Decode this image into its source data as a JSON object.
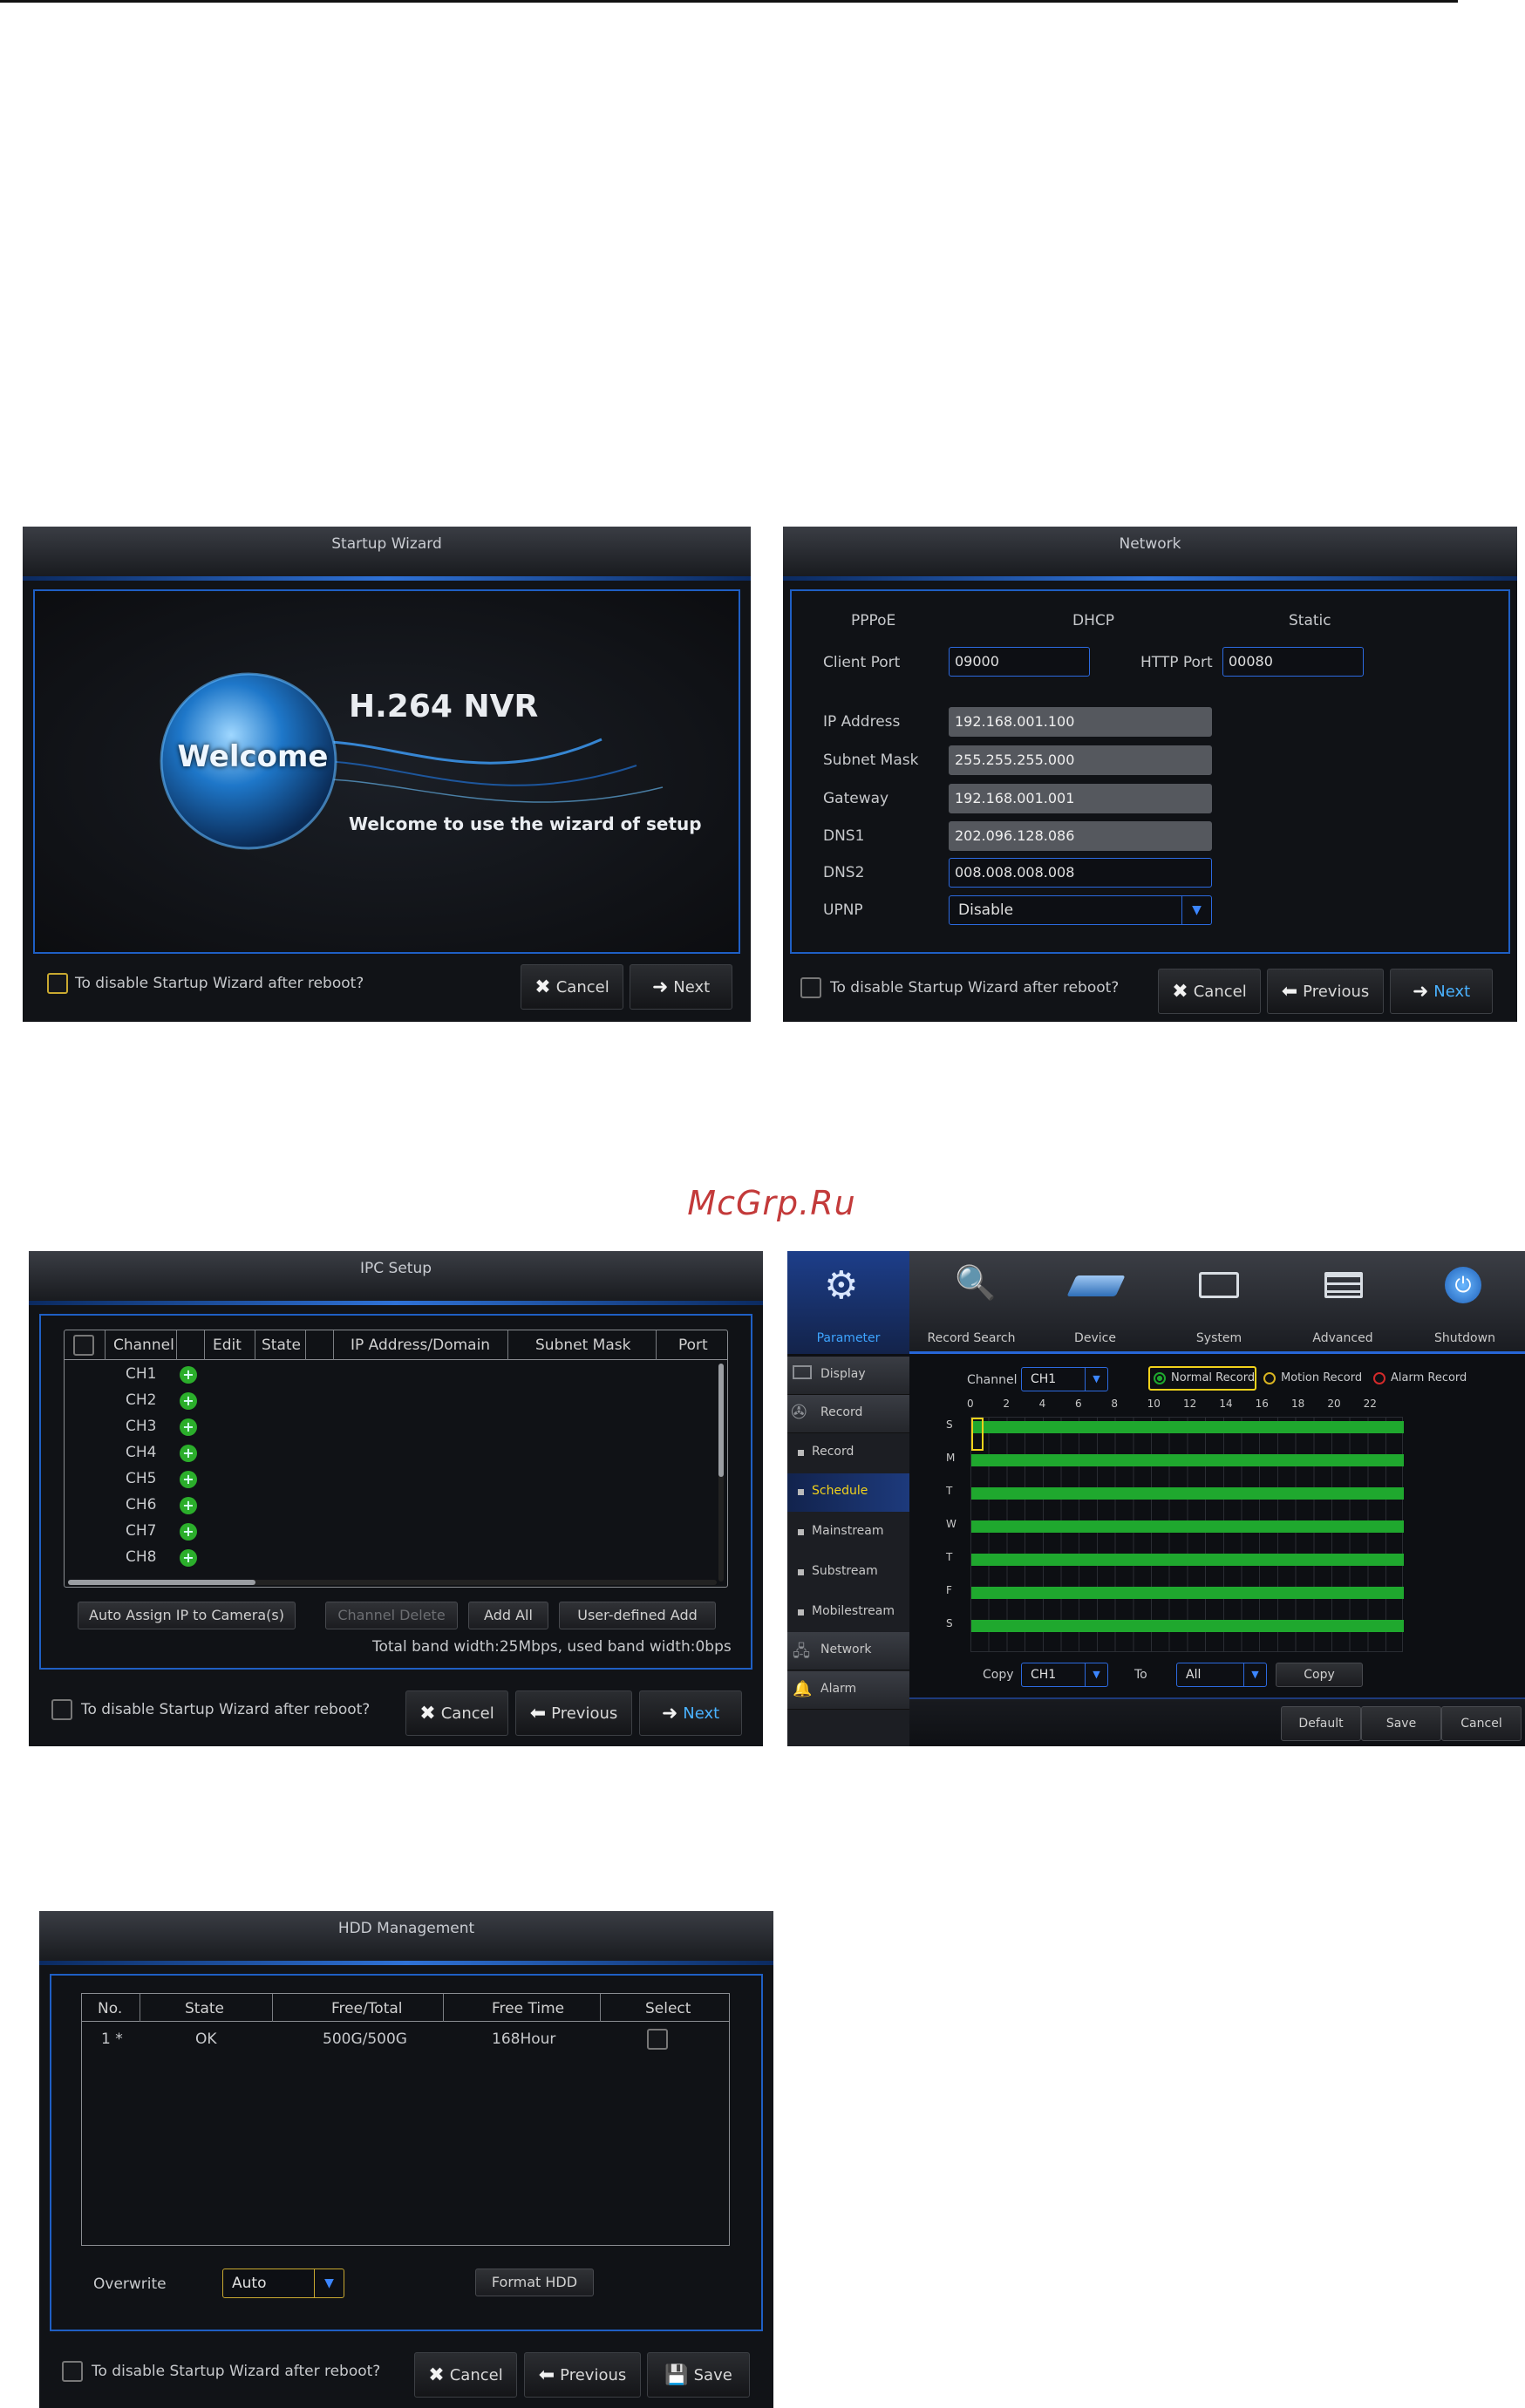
{
  "watermark": "McGrp.Ru",
  "common": {
    "disable_wizard_label": "To disable Startup Wizard after reboot?",
    "cancel_label": "Cancel",
    "next_label": "Next",
    "previous_label": "Previous",
    "save_label": "Save"
  },
  "welcome": {
    "title": "Startup Wizard",
    "product": "H.264 NVR",
    "welcome_text": "Welcome",
    "subtitle": "Welcome to use the wizard of setup"
  },
  "network": {
    "title": "Network",
    "modes": [
      "PPPoE",
      "DHCP",
      "Static"
    ],
    "client_port_label": "Client Port",
    "client_port": "09000",
    "http_port_label": "HTTP Port",
    "http_port": "00080",
    "ip_label": "IP Address",
    "ip": "192.168.001.100",
    "subnet_label": "Subnet Mask",
    "subnet": "255.255.255.000",
    "gateway_label": "Gateway",
    "gateway": "192.168.001.001",
    "dns1_label": "DNS1",
    "dns1": "202.096.128.086",
    "dns2_label": "DNS2",
    "dns2": "008.008.008.008",
    "upnp_label": "UPNP",
    "upnp": "Disable"
  },
  "ipc": {
    "title": "IPC Setup",
    "headers": [
      "Channel",
      "Edit",
      "State",
      "IP Address/Domain",
      "Subnet Mask",
      "Port"
    ],
    "channels": [
      "CH1",
      "CH2",
      "CH3",
      "CH4",
      "CH5",
      "CH6",
      "CH7",
      "CH8"
    ],
    "auto_assign": "Auto Assign IP to Camera(s)",
    "channel_delete": "Channel Delete",
    "add_all": "Add All",
    "user_defined": "User-defined Add",
    "bandwidth": "Total band width:25Mbps, used band width:0bps"
  },
  "schedule": {
    "top_tabs": [
      "Parameter",
      "Record Search",
      "Device",
      "System",
      "Advanced",
      "Shutdown"
    ],
    "side_items": [
      "Display",
      "Record",
      "Record",
      "Schedule",
      "Mainstream",
      "Substream",
      "Mobilestream",
      "Network",
      "Alarm"
    ],
    "channel_label": "Channel",
    "channel": "CH1",
    "legend_normal": "Normal Record",
    "legend_motion": "Motion Record",
    "legend_alarm": "Alarm Record",
    "hours": [
      "0",
      "2",
      "4",
      "6",
      "8",
      "10",
      "12",
      "14",
      "16",
      "18",
      "20",
      "22"
    ],
    "days": [
      "S",
      "M",
      "T",
      "W",
      "T",
      "F",
      "S"
    ],
    "copy_label": "Copy",
    "copy_from": "CH1",
    "to_label": "To",
    "copy_to": "All",
    "copy_button": "Copy",
    "default_button": "Default",
    "save_button": "Save",
    "cancel_button": "Cancel",
    "colors": {
      "normal": "#1fa82e",
      "motion": "#d8b321",
      "alarm": "#d22a2a",
      "accent": "#f2d21b"
    }
  },
  "hdd": {
    "title": "HDD Management",
    "headers": [
      "No.",
      "State",
      "Free/Total",
      "Free Time",
      "Select"
    ],
    "row": {
      "no": "1 *",
      "state": "OK",
      "free_total": "500G/500G",
      "free_time": "168Hour"
    },
    "overwrite_label": "Overwrite",
    "overwrite": "Auto",
    "format_button": "Format HDD"
  }
}
